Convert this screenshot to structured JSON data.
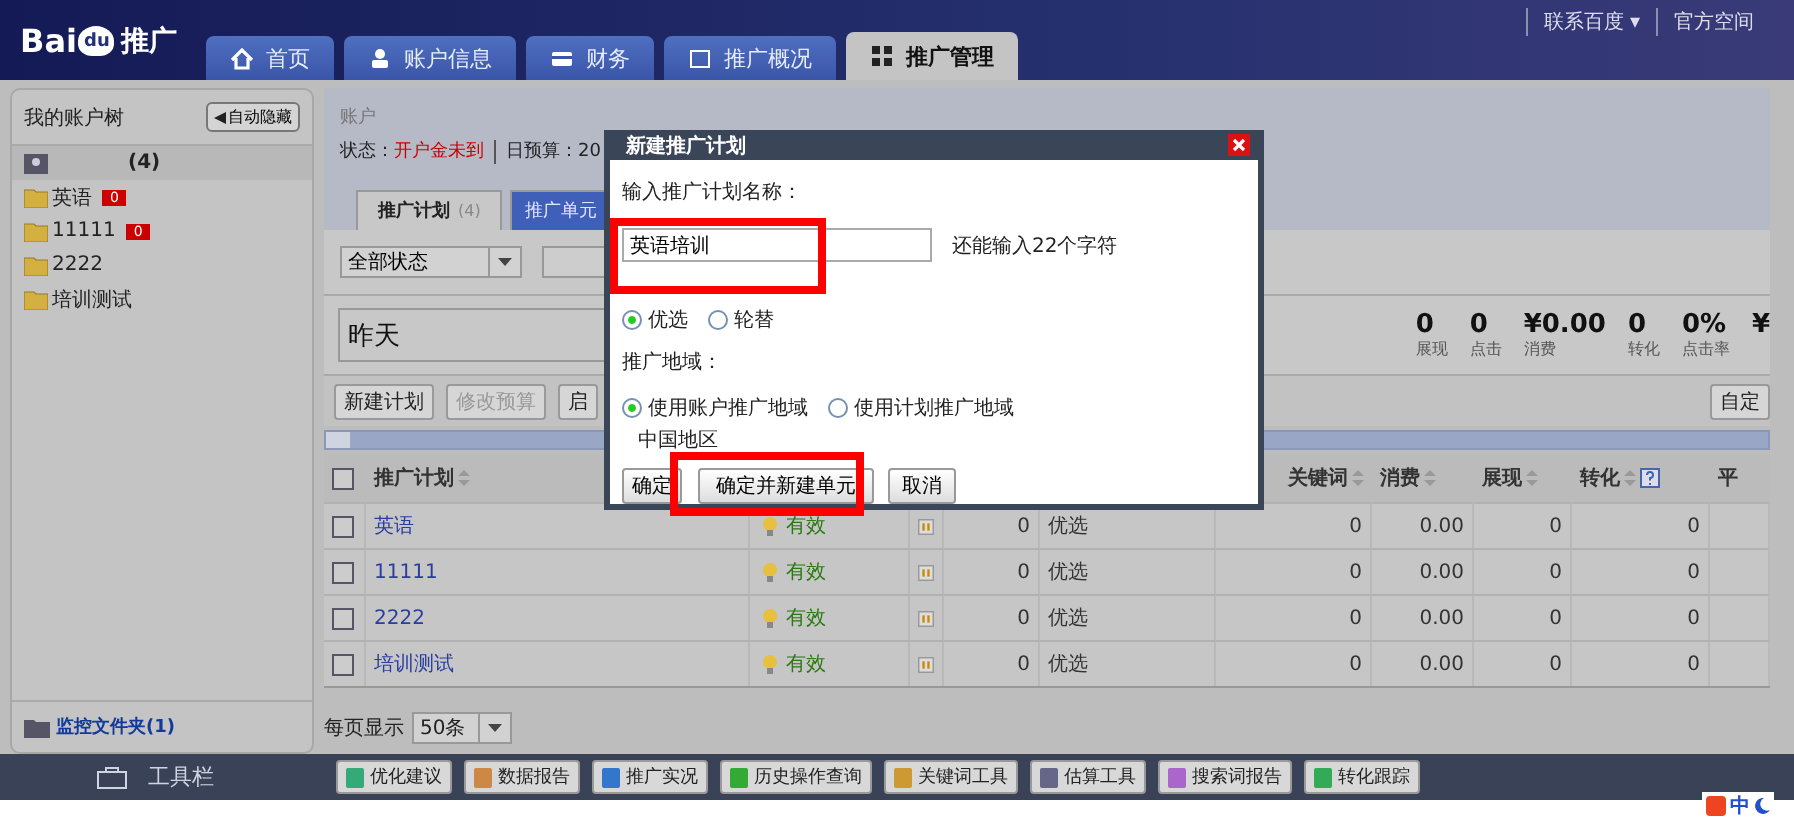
{
  "brand": {
    "prefix": "Bai",
    "mark": "du",
    "name": "推广"
  },
  "nav_tabs": [
    {
      "label": "首页",
      "selected": false
    },
    {
      "label": "账户信息",
      "selected": false
    },
    {
      "label": "财务",
      "selected": false
    },
    {
      "label": "推广概况",
      "selected": false
    },
    {
      "label": "推广管理",
      "selected": true
    }
  ],
  "top_links": [
    "联系百度 ▾",
    "官方空间"
  ],
  "sidebar": {
    "title": "我的账户树",
    "hide_button": "自动隐藏",
    "account_count": "(4)",
    "folders": [
      {
        "name": "英语",
        "badge": "0"
      },
      {
        "name": "11111",
        "badge": "0"
      },
      {
        "name": "2222"
      },
      {
        "name": "培训测试"
      }
    ],
    "monitor": "监控文件夹(1)"
  },
  "account": {
    "label": "账户",
    "status_label": "状态：",
    "status": "开户金未到",
    "budget": "日预算：20"
  },
  "sub_tabs": [
    {
      "label": "推广计划",
      "count": "(4)",
      "selected": true
    },
    {
      "label": "推广单元",
      "selected": false
    }
  ],
  "filter": {
    "status": "全部状态"
  },
  "date": "昨天",
  "stats": [
    {
      "value": "0",
      "label": "展现"
    },
    {
      "value": "0",
      "label": "点击"
    },
    {
      "value": "¥0.00",
      "label": "消费"
    },
    {
      "value": "0",
      "label": "转化"
    },
    {
      "value": "0%",
      "label": "点击率"
    },
    {
      "value": "¥"
    }
  ],
  "actions": [
    {
      "label": "新建计划",
      "disabled": false
    },
    {
      "label": "修改预算",
      "disabled": true
    },
    {
      "label": "启",
      "disabled": false
    }
  ],
  "custom_button": "自定",
  "table": {
    "select_all_checked": false,
    "columns": [
      {
        "label": "推广计划",
        "sortable": true
      },
      {
        "label": "关键词",
        "sortable": true
      },
      {
        "label": "消费",
        "sortable": true
      },
      {
        "label": "展现",
        "sortable": true
      },
      {
        "label": "转化",
        "sortable": true,
        "help": true
      },
      {
        "label": "平",
        "sortable": false
      }
    ],
    "rows": [
      {
        "checked": false,
        "name": "英语",
        "status": "有效",
        "cells": [
          "0",
          "优选",
          "0",
          "0.00",
          "0",
          "0"
        ]
      },
      {
        "checked": false,
        "name": "11111",
        "status": "有效",
        "cells": [
          "0",
          "优选",
          "0",
          "0.00",
          "0",
          "0"
        ]
      },
      {
        "checked": false,
        "name": "2222",
        "status": "有效",
        "cells": [
          "0",
          "优选",
          "0",
          "0.00",
          "0",
          "0"
        ]
      },
      {
        "checked": false,
        "name": "培训测试",
        "status": "有效",
        "cells": [
          "0",
          "优选",
          "0",
          "0.00",
          "0",
          "0"
        ]
      }
    ]
  },
  "pager": {
    "label": "每页显示",
    "value": "50条"
  },
  "toolbar": {
    "title": "工具栏",
    "tools": [
      "优化建议",
      "数据报告",
      "推广实况",
      "历史操作查询",
      "关键词工具",
      "估算工具",
      "搜索词报告",
      "转化跟踪"
    ]
  },
  "tray": {
    "ime": "中"
  },
  "dialog": {
    "title": "新建推广计划",
    "name_label": "输入推广计划名称：",
    "name_value": "英语培训",
    "remaining": "还能输入22个字符",
    "mode_options": [
      {
        "label": "优选",
        "selected": true
      },
      {
        "label": "轮替",
        "selected": false
      }
    ],
    "region_label": "推广地域：",
    "region_options": [
      {
        "label": "使用账户推广地域",
        "selected": true
      },
      {
        "label": "使用计划推广地域",
        "selected": false
      }
    ],
    "region_note": "中国地区",
    "buttons": [
      "确定",
      "确定并新建单元",
      "取消"
    ]
  }
}
